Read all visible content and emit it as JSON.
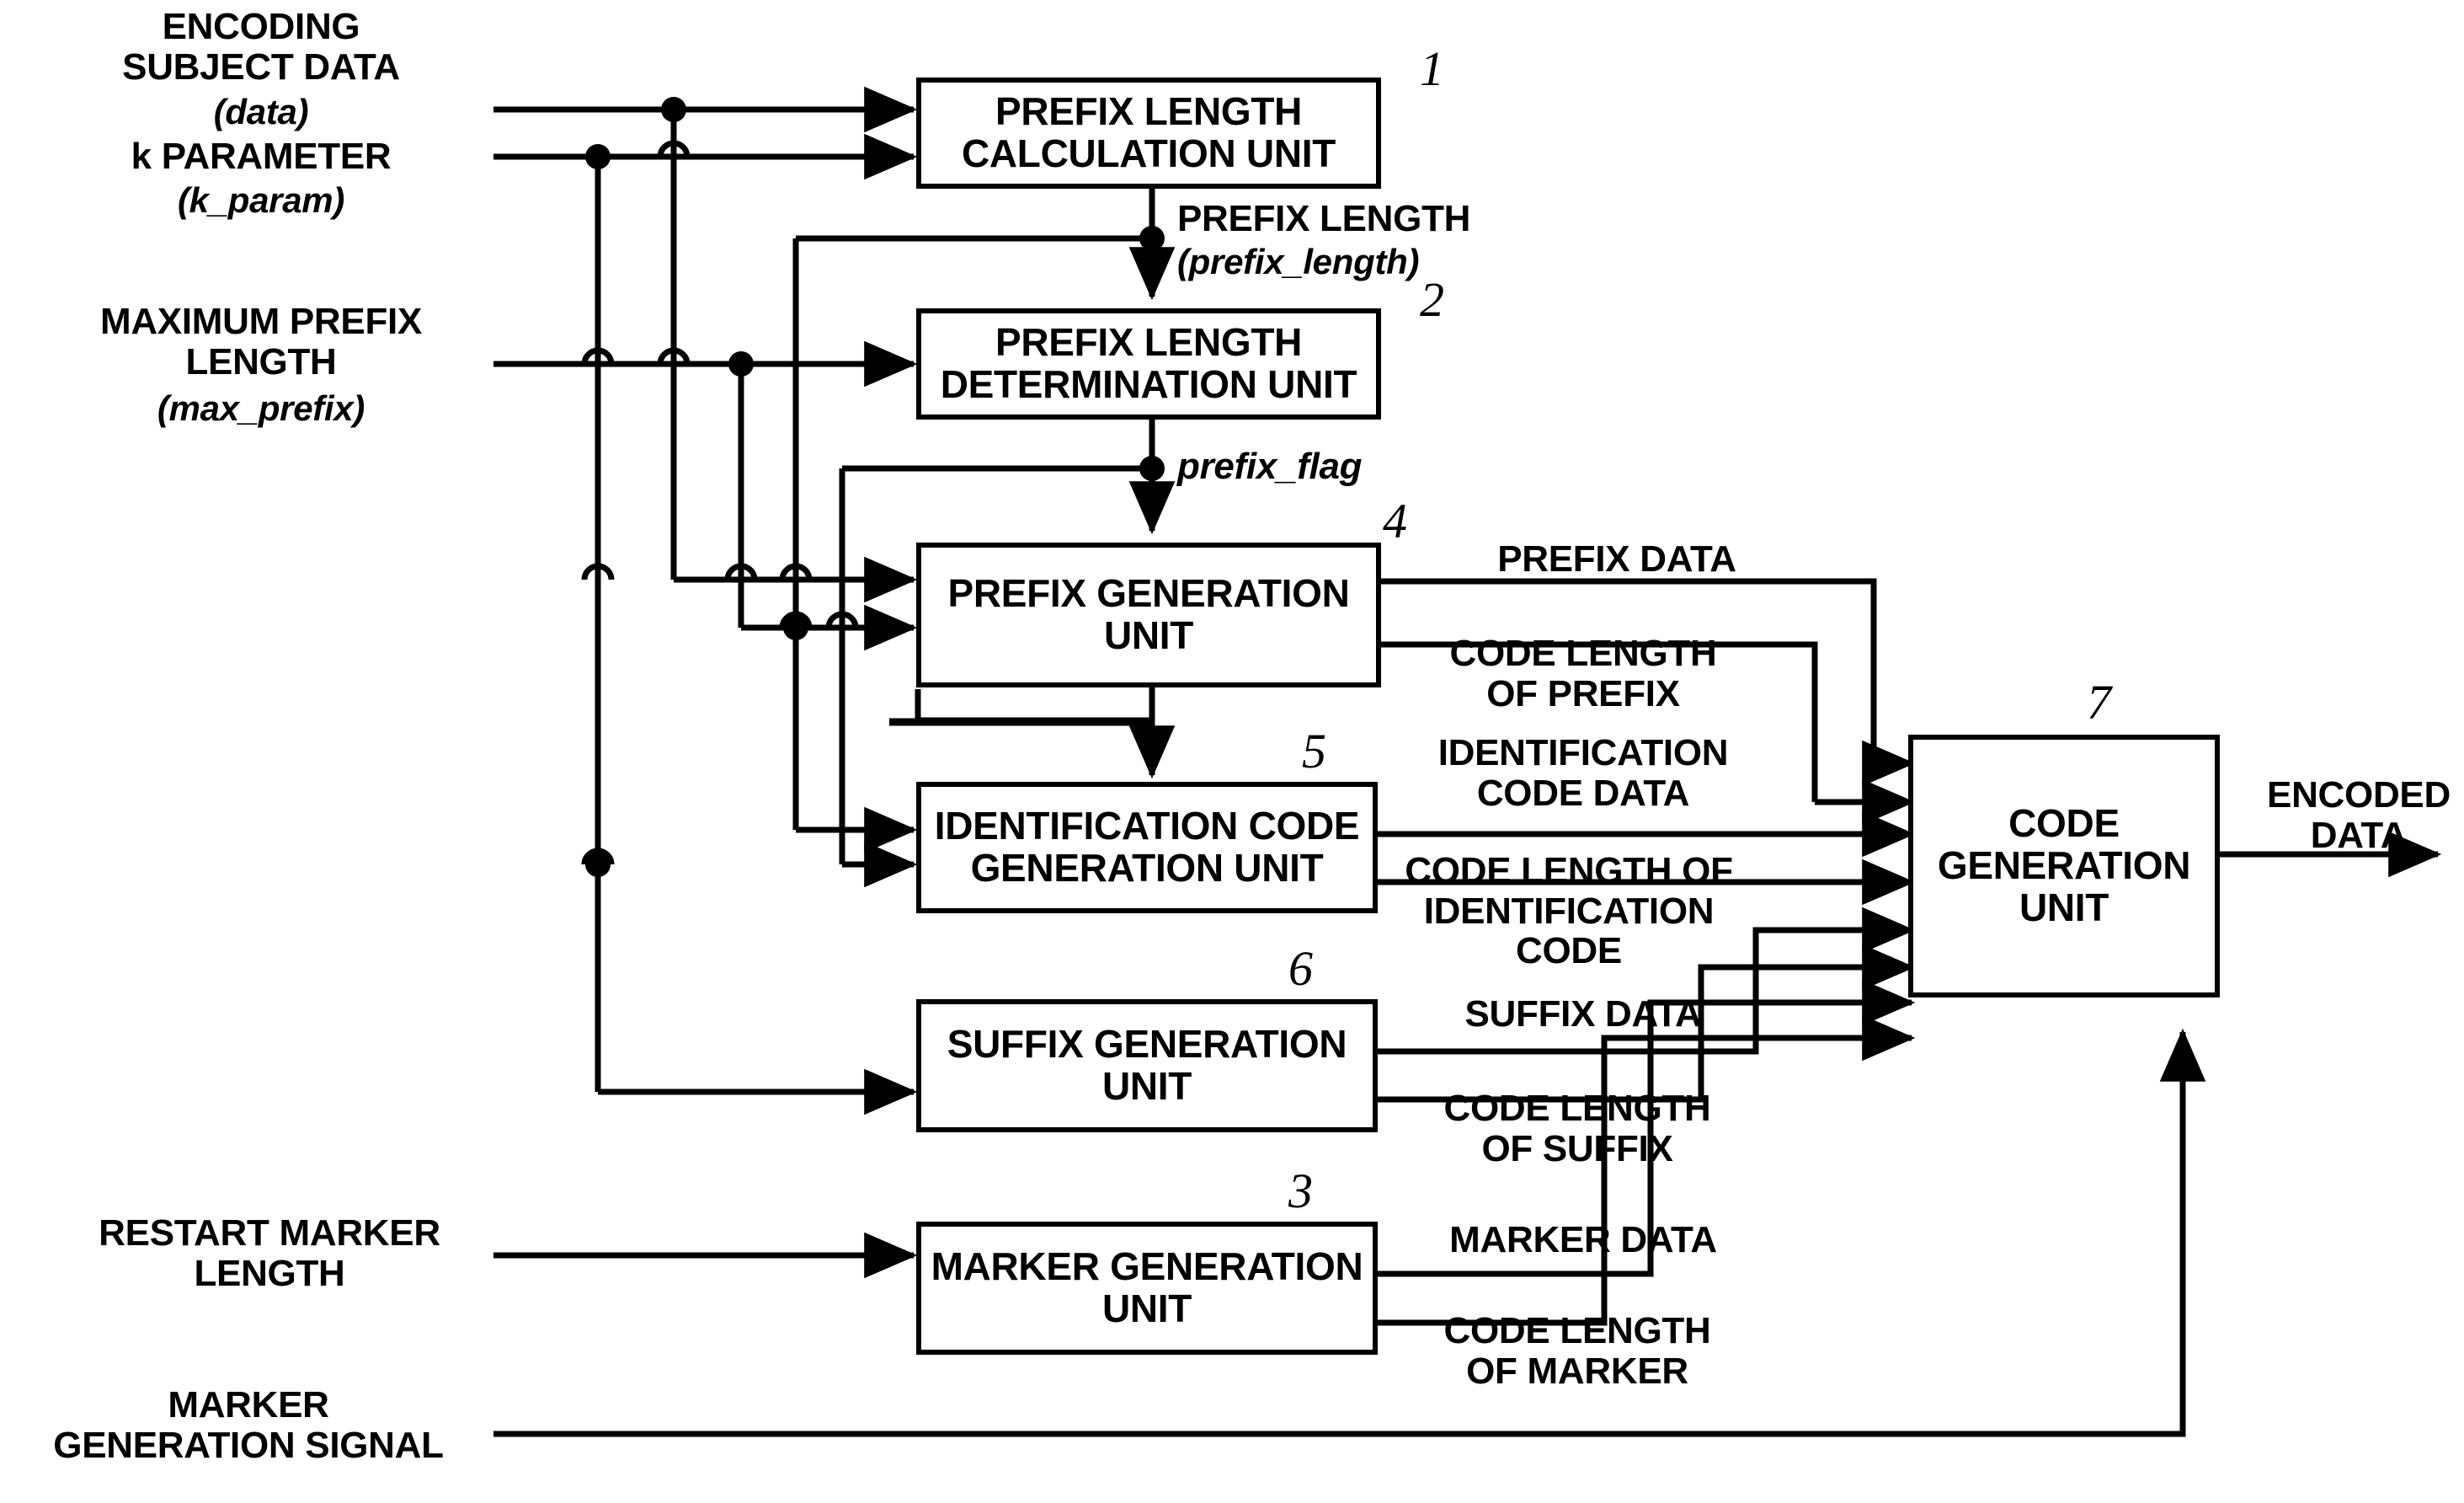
{
  "diagram": {
    "type": "block-diagram",
    "title": "Encoding apparatus block diagram",
    "inputs": [
      {
        "id": "data",
        "label": "ENCODING\nSUBJECT DATA",
        "signal": "(data)"
      },
      {
        "id": "k_param",
        "label": "k PARAMETER",
        "signal": "(k_param)"
      },
      {
        "id": "max_prefix",
        "label": "MAXIMUM PREFIX\nLENGTH",
        "signal": "(max_prefix)"
      },
      {
        "id": "restart_marker_length",
        "label": "RESTART MARKER\nLENGTH",
        "signal": ""
      },
      {
        "id": "marker_generation_signal",
        "label": "MARKER\nGENERATION SIGNAL",
        "signal": ""
      }
    ],
    "blocks": [
      {
        "ref": "1",
        "name": "prefix-length-calculation-unit",
        "label": "PREFIX LENGTH\nCALCULATION UNIT"
      },
      {
        "ref": "2",
        "name": "prefix-length-determination-unit",
        "label": "PREFIX LENGTH\nDETERMINATION UNIT"
      },
      {
        "ref": "3",
        "name": "marker-generation-unit",
        "label": "MARKER\nGENERATION UNIT"
      },
      {
        "ref": "4",
        "name": "prefix-generation-unit",
        "label": "PREFIX\nGENERATION UNIT"
      },
      {
        "ref": "5",
        "name": "identification-code-generation-unit",
        "label": "IDENTIFICATION CODE\nGENERATION UNIT"
      },
      {
        "ref": "6",
        "name": "suffix-generation-unit",
        "label": "SUFFIX\nGENERATION UNIT"
      },
      {
        "ref": "7",
        "name": "code-generation-unit",
        "label": "CODE\nGENERATION\nUNIT"
      }
    ],
    "signals": [
      {
        "id": "prefix_length",
        "label": "PREFIX LENGTH",
        "signal": "(prefix_length)"
      },
      {
        "id": "prefix_flag",
        "label": "",
        "signal": "prefix_flag"
      },
      {
        "id": "prefix_data",
        "label": "PREFIX DATA",
        "signal": ""
      },
      {
        "id": "code_length_of_prefix",
        "label": "CODE LENGTH\nOF PREFIX",
        "signal": ""
      },
      {
        "id": "identification_code_data",
        "label": "IDENTIFICATION\nCODE DATA",
        "signal": ""
      },
      {
        "id": "code_length_of_identification_code",
        "label": "CODE LENGTH OF\nIDENTIFICATION\nCODE",
        "signal": ""
      },
      {
        "id": "suffix_data",
        "label": "SUFFIX DATA",
        "signal": ""
      },
      {
        "id": "code_length_of_suffix",
        "label": "CODE LENGTH\nOF SUFFIX",
        "signal": ""
      },
      {
        "id": "marker_data",
        "label": "MARKER DATA",
        "signal": ""
      },
      {
        "id": "code_length_of_marker",
        "label": "CODE LENGTH\nOF MARKER",
        "signal": ""
      }
    ],
    "outputs": [
      {
        "id": "encoded_data",
        "label": "ENCODED\nDATA"
      }
    ],
    "colors": {
      "line": "#000000",
      "background": "#ffffff",
      "text": "#000000"
    }
  }
}
